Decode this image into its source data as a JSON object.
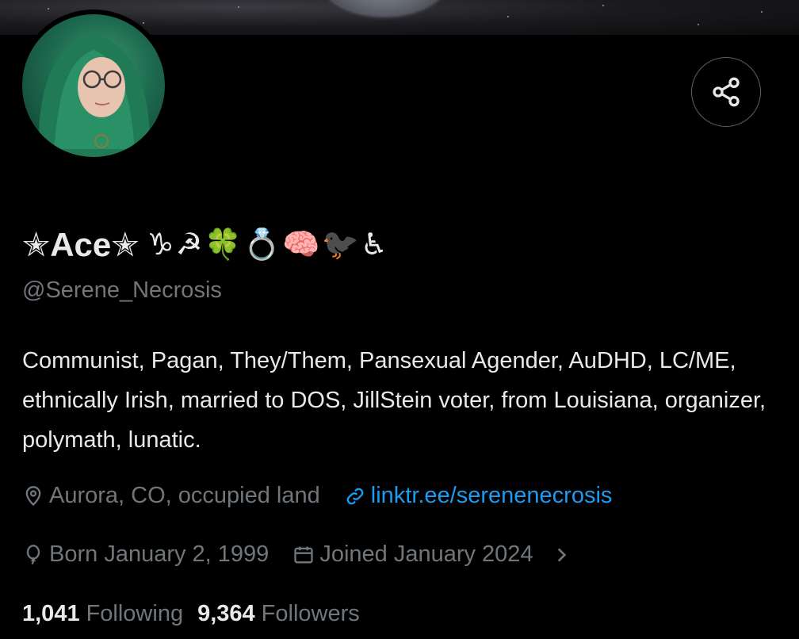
{
  "profile": {
    "display_name": "✭Ace✭",
    "name_emoji": "♑☭🍀💍🧠🐦‍⬛♿",
    "handle": "@Serene_Necrosis",
    "bio": "Communist, Pagan, They/Them, Pansexual Agender, AuDHD, LC/ME, ethnically Irish, married to DOS, JillStein voter, from Louisiana, organizer, polymath, lunatic.",
    "location": "Aurora, CO, occupied land",
    "website": "linktr.ee/serenenecrosis",
    "birthday": "Born January 2, 1999",
    "joined": "Joined January 2024"
  },
  "stats": {
    "following_count": "1,041",
    "following_label": "Following",
    "followers_count": "9,364",
    "followers_label": "Followers"
  },
  "icons": {
    "share": "share-icon",
    "location": "location-pin-icon",
    "link": "link-icon",
    "birthday": "balloon-icon",
    "calendar": "calendar-icon",
    "chevron": "chevron-right-icon"
  },
  "colors": {
    "background": "#000000",
    "text": "#e7e9ea",
    "muted": "#71767b",
    "link": "#1d9bf0",
    "border": "#536471"
  }
}
